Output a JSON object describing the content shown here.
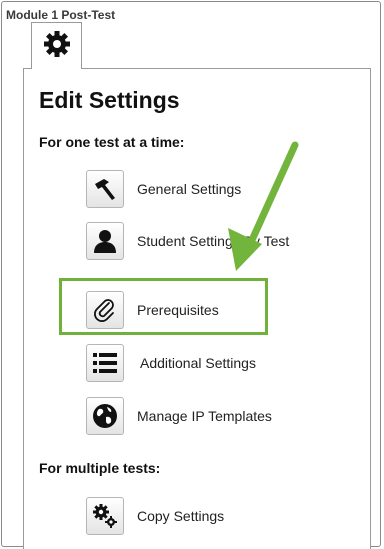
{
  "window": {
    "title": "Module 1 Post-Test"
  },
  "tab": {
    "icon": "gear-icon"
  },
  "panel": {
    "title": "Edit Settings"
  },
  "sections": {
    "single": "For one test at a time:",
    "multiple": "For multiple tests:"
  },
  "items": {
    "general": "General Settings",
    "student": "Student Settings By Test",
    "prerequisites": "Prerequisites",
    "additional": "Additional Settings",
    "ip_templates": "Manage IP Templates",
    "copy": "Copy Settings"
  },
  "colors": {
    "highlight": "#6fb13a",
    "arrow": "#72b43c"
  }
}
